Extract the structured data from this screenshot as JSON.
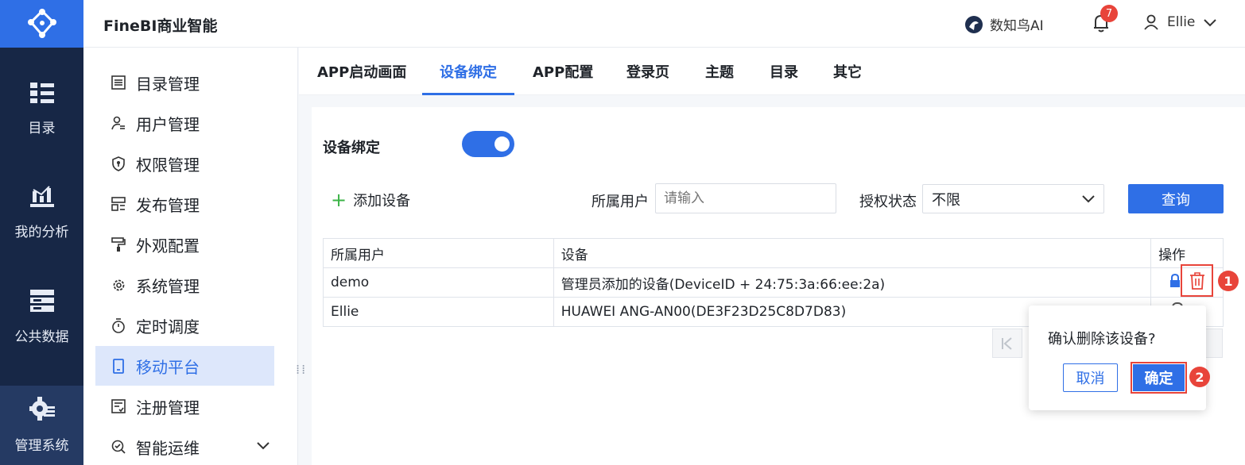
{
  "app": {
    "title": "FineBI商业智能",
    "logo_icon": "finebi-logo-icon"
  },
  "leftnav": {
    "items": [
      {
        "label": "目录",
        "icon": "catalog-icon"
      },
      {
        "label": "我的分析",
        "icon": "analysis-chart-icon"
      },
      {
        "label": "公共数据",
        "icon": "database-icon"
      },
      {
        "label": "管理系统",
        "icon": "admin-gear-icon",
        "active": true
      }
    ]
  },
  "header": {
    "ai_label": "数知鸟AI",
    "notification_count": "7",
    "user_name": "Ellie"
  },
  "submenu": {
    "items": [
      {
        "label": "目录管理",
        "icon": "list-icon"
      },
      {
        "label": "用户管理",
        "icon": "user-list-icon"
      },
      {
        "label": "权限管理",
        "icon": "shield-icon"
      },
      {
        "label": "发布管理",
        "icon": "publish-icon"
      },
      {
        "label": "外观配置",
        "icon": "paint-roller-icon"
      },
      {
        "label": "系统管理",
        "icon": "gear-icon"
      },
      {
        "label": "定时调度",
        "icon": "stopwatch-icon"
      },
      {
        "label": "移动平台",
        "icon": "mobile-icon",
        "active": true
      },
      {
        "label": "注册管理",
        "icon": "register-icon"
      },
      {
        "label": "智能运维",
        "icon": "ops-icon"
      }
    ]
  },
  "tabs": [
    "APP启动画面",
    "设备绑定",
    "APP配置",
    "登录页",
    "主题",
    "目录",
    "其它"
  ],
  "active_tab": "设备绑定",
  "device_binding": {
    "label": "设备绑定",
    "enabled": true,
    "add_device": "添加设备",
    "user_filter_label": "所属用户",
    "user_filter_placeholder": "请输入",
    "auth_status_label": "授权状态",
    "auth_status_value": "不限",
    "query_button": "查询"
  },
  "table": {
    "headers": [
      "所属用户",
      "设备",
      "操作"
    ],
    "rows": [
      {
        "user": "demo",
        "device": "管理员添加的设备(DeviceID + 24:75:3a:66:ee:2a)"
      },
      {
        "user": "Ellie",
        "device": "HUAWEI ANG-AN00(DE3F23D25C8D7D83)"
      }
    ]
  },
  "confirm": {
    "message": "确认删除该设备?",
    "cancel": "取消",
    "ok": "确定"
  },
  "steps": {
    "one": "1",
    "two": "2"
  },
  "colors": {
    "primary": "#2f6fe6",
    "nav_dark": "#172746",
    "danger": "#e8443a"
  }
}
